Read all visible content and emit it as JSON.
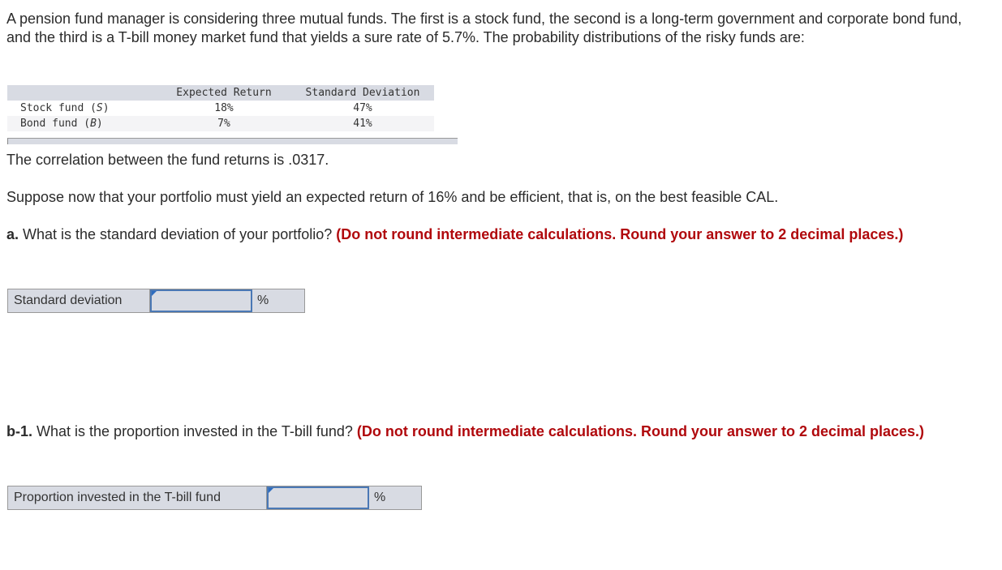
{
  "intro": "A pension fund manager is considering three mutual funds. The first is a stock fund, the second is a long-term government and corporate bond fund, and the third is a T-bill money market fund that yields a sure rate of 5.7%. The probability distributions of the risky funds are:",
  "table": {
    "headers": [
      "",
      "Expected Return",
      "Standard Deviation"
    ],
    "rows": [
      {
        "name": "Stock fund (",
        "sym": "S",
        "close": ")",
        "er": "18%",
        "sd": "47%"
      },
      {
        "name": "Bond fund (",
        "sym": "B",
        "close": ")",
        "er": "7%",
        "sd": "41%"
      }
    ]
  },
  "correlation": "The correlation between the fund returns is .0317.",
  "suppose": "Suppose now that your portfolio must yield an expected return of 16% and be efficient, that is, on the best feasible CAL.",
  "qa": {
    "label": "a.",
    "text": " What is the standard deviation of your portfolio? ",
    "instruction": "(Do not round intermediate calculations. Round your answer to 2 decimal places.)",
    "input_label": "Standard deviation",
    "input_value": "",
    "unit": "%"
  },
  "qb1": {
    "label": "b-1.",
    "text": " What is the proportion invested in the T-bill fund? ",
    "instruction": "(Do not round intermediate calculations. Round your answer to 2 decimal places.)",
    "input_label": "Proportion invested in the T-bill fund",
    "input_value": "",
    "unit": "%"
  }
}
